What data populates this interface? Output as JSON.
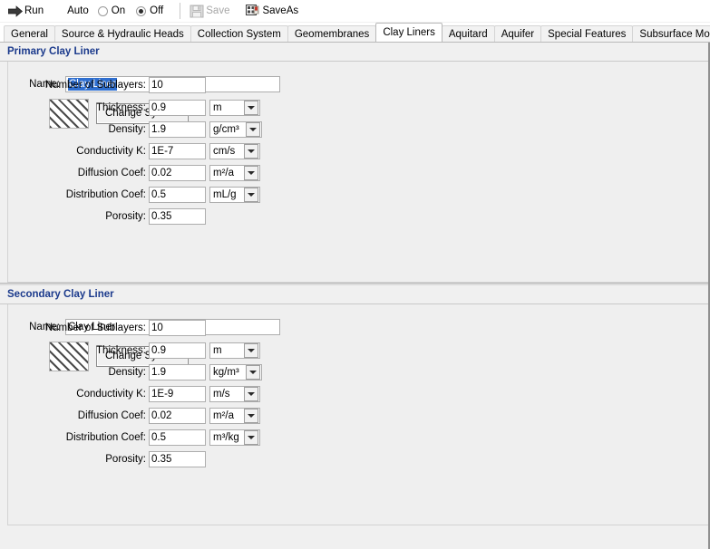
{
  "toolbar": {
    "run_label": "Run",
    "run_icon": "right-arrow-icon",
    "auto_label": "Auto",
    "radio_on_label": "On",
    "radio_off_label": "Off",
    "radio_selected": "Off",
    "save_label": "Save",
    "save_icon": "floppy-disk-icon",
    "save_enabled": false,
    "saveas_label": "SaveAs",
    "saveas_icon": "save-as-icon"
  },
  "tabs": [
    {
      "label": "General",
      "active": false
    },
    {
      "label": "Source & Hydraulic Heads",
      "active": false
    },
    {
      "label": "Collection System",
      "active": false
    },
    {
      "label": "Geomembranes",
      "active": false
    },
    {
      "label": "Clay Liners",
      "active": true
    },
    {
      "label": "Aquitard",
      "active": false
    },
    {
      "label": "Aquifer",
      "active": false
    },
    {
      "label": "Special Features",
      "active": false
    },
    {
      "label": "Subsurface Model",
      "active": false
    }
  ],
  "colors": {
    "section_header_text": "#1b3a8c",
    "selection_background": "#2f6fd0",
    "panel_background": "#efefef"
  },
  "sections": [
    {
      "id": "primary",
      "header": "Primary Clay Liner",
      "name_label": "Name:",
      "name_value": "Clay Liner",
      "name_selected": true,
      "symbol_icon": "diagonal-hatch-pattern-icon",
      "change_symbol_label": "Change Symbol",
      "fields": [
        {
          "label": "Number of Sublayers:",
          "value": "10",
          "unit": null
        },
        {
          "label": "Thickness:",
          "value": "0.9",
          "unit": "m"
        },
        {
          "label": "Density:",
          "value": "1.9",
          "unit": "g/cm³"
        },
        {
          "label": "Conductivity K:",
          "value": "1E-7",
          "unit": "cm/s"
        },
        {
          "label": "Diffusion Coef:",
          "value": "0.02",
          "unit": "m²/a"
        },
        {
          "label": "Distribution Coef:",
          "value": "0.5",
          "unit": "mL/g"
        },
        {
          "label": "Porosity:",
          "value": "0.35",
          "unit": null
        }
      ]
    },
    {
      "id": "secondary",
      "header": "Secondary Clay Liner",
      "name_label": "Name:",
      "name_value": "Clay Liner",
      "name_selected": false,
      "symbol_icon": "diagonal-hatch-pattern-icon",
      "change_symbol_label": "Change Symbol",
      "fields": [
        {
          "label": "Number of Sublayers:",
          "value": "10",
          "unit": null
        },
        {
          "label": "Thickness:",
          "value": "0.9",
          "unit": "m"
        },
        {
          "label": "Density:",
          "value": "1.9",
          "unit": "kg/m³"
        },
        {
          "label": "Conductivity K:",
          "value": "1E-9",
          "unit": "m/s"
        },
        {
          "label": "Diffusion Coef:",
          "value": "0.02",
          "unit": "m²/a"
        },
        {
          "label": "Distribution Coef:",
          "value": "0.5",
          "unit": "m³/kg"
        },
        {
          "label": "Porosity:",
          "value": "0.35",
          "unit": null
        }
      ]
    }
  ]
}
